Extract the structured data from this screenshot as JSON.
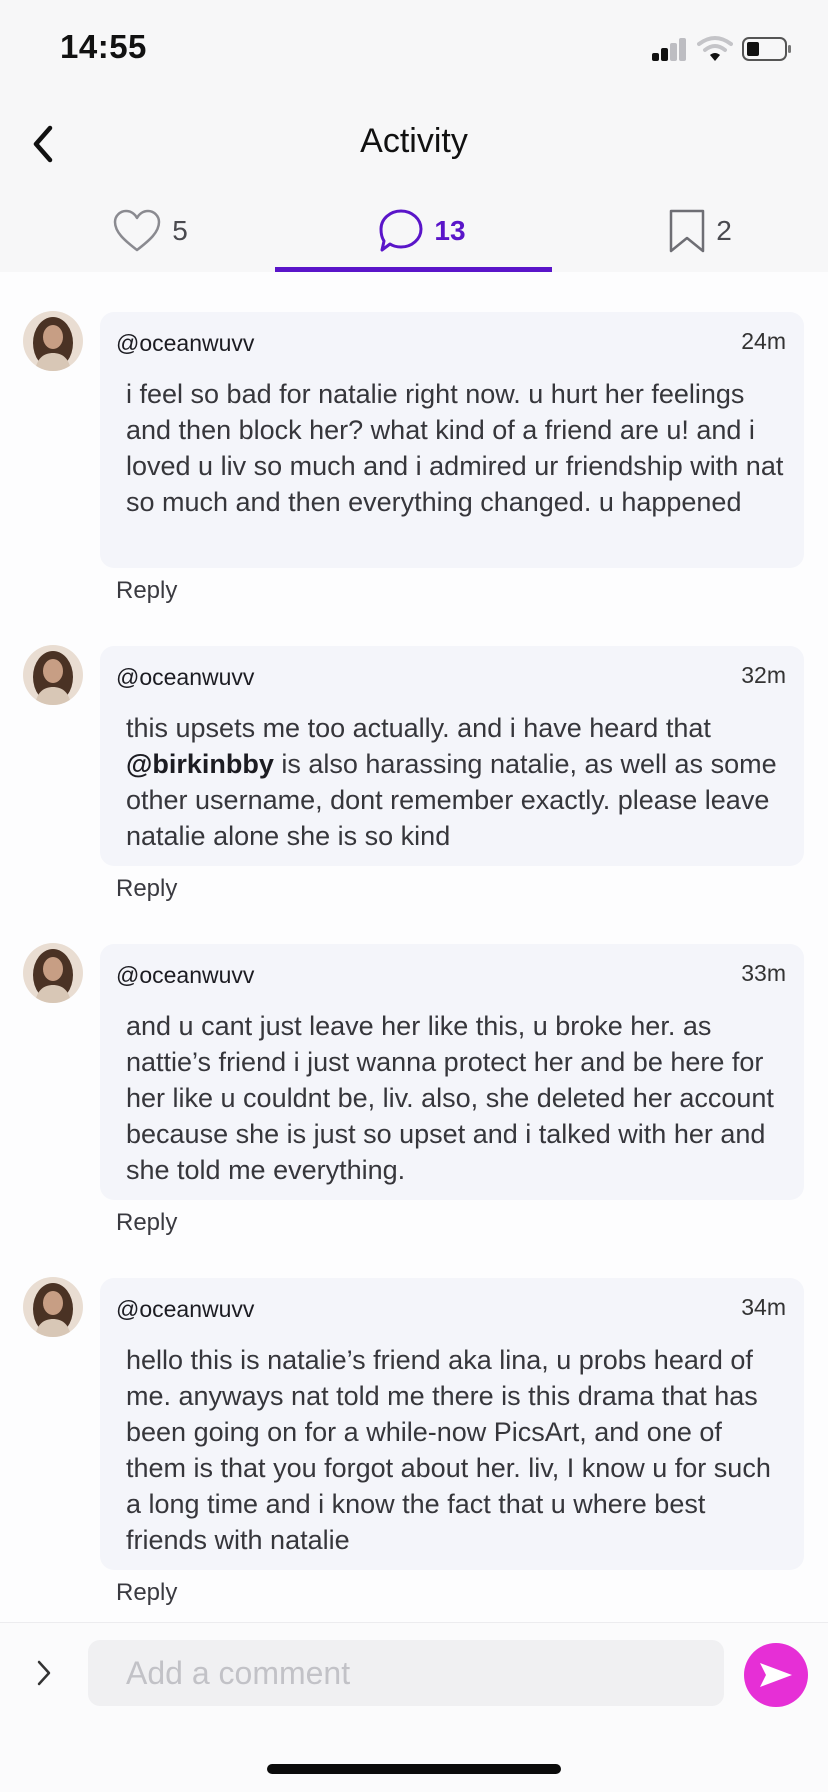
{
  "status_bar": {
    "time": "14:55",
    "signal_icon": "cellular-signal-icon",
    "wifi_icon": "wifi-icon",
    "battery_icon": "battery-icon"
  },
  "header": {
    "title": "Activity",
    "back_icon": "chevron-left-icon"
  },
  "tabs": [
    {
      "icon": "heart-icon",
      "count": "5",
      "active": false
    },
    {
      "icon": "comment-bubble-icon",
      "count": "13",
      "active": true
    },
    {
      "icon": "bookmark-icon",
      "count": "2",
      "active": false
    }
  ],
  "comments": [
    {
      "username": "@oceanwuvv",
      "time": "24m",
      "text": "i feel so bad for natalie right now. u hurt her feelings and then block her? what kind of a friend are u! and i loved u liv so much and i admired ur friendship with nat so much and then everything changed. u happened",
      "reply_label": "Reply"
    },
    {
      "username": "@oceanwuvv",
      "time": "32m",
      "text_before": "this upsets me too actually. and i have heard that ",
      "mention": "@birkinbby",
      "text_after": " is also harassing natalie, as well as some other username, dont remember exactly. please leave natalie alone she is so kind",
      "reply_label": "Reply"
    },
    {
      "username": "@oceanwuvv",
      "time": "33m",
      "text": "and u cant just leave her like this, u broke her. as nattie’s friend i just wanna protect her and be here for her like u couldnt be, liv. also, she deleted her account because she is just so upset and i talked with her and she told me everything.",
      "reply_label": "Reply"
    },
    {
      "username": "@oceanwuvv",
      "time": "34m",
      "text": "hello this is natalie’s friend aka lina, u probs heard of me. anyways nat told me there is this drama that has been going on for a while-now  PicsArt, and one of them is that you forgot about her. liv, I know u for such a long time and i know the fact that u where best friends with natalie",
      "reply_label": "Reply"
    }
  ],
  "composer": {
    "placeholder": "Add a comment",
    "value": "",
    "expand_icon": "chevron-right-icon",
    "send_icon": "send-icon"
  },
  "colors": {
    "accent": "#5a15c9",
    "send_button": "#e62fd6",
    "bubble_bg": "#f4f5fa"
  }
}
